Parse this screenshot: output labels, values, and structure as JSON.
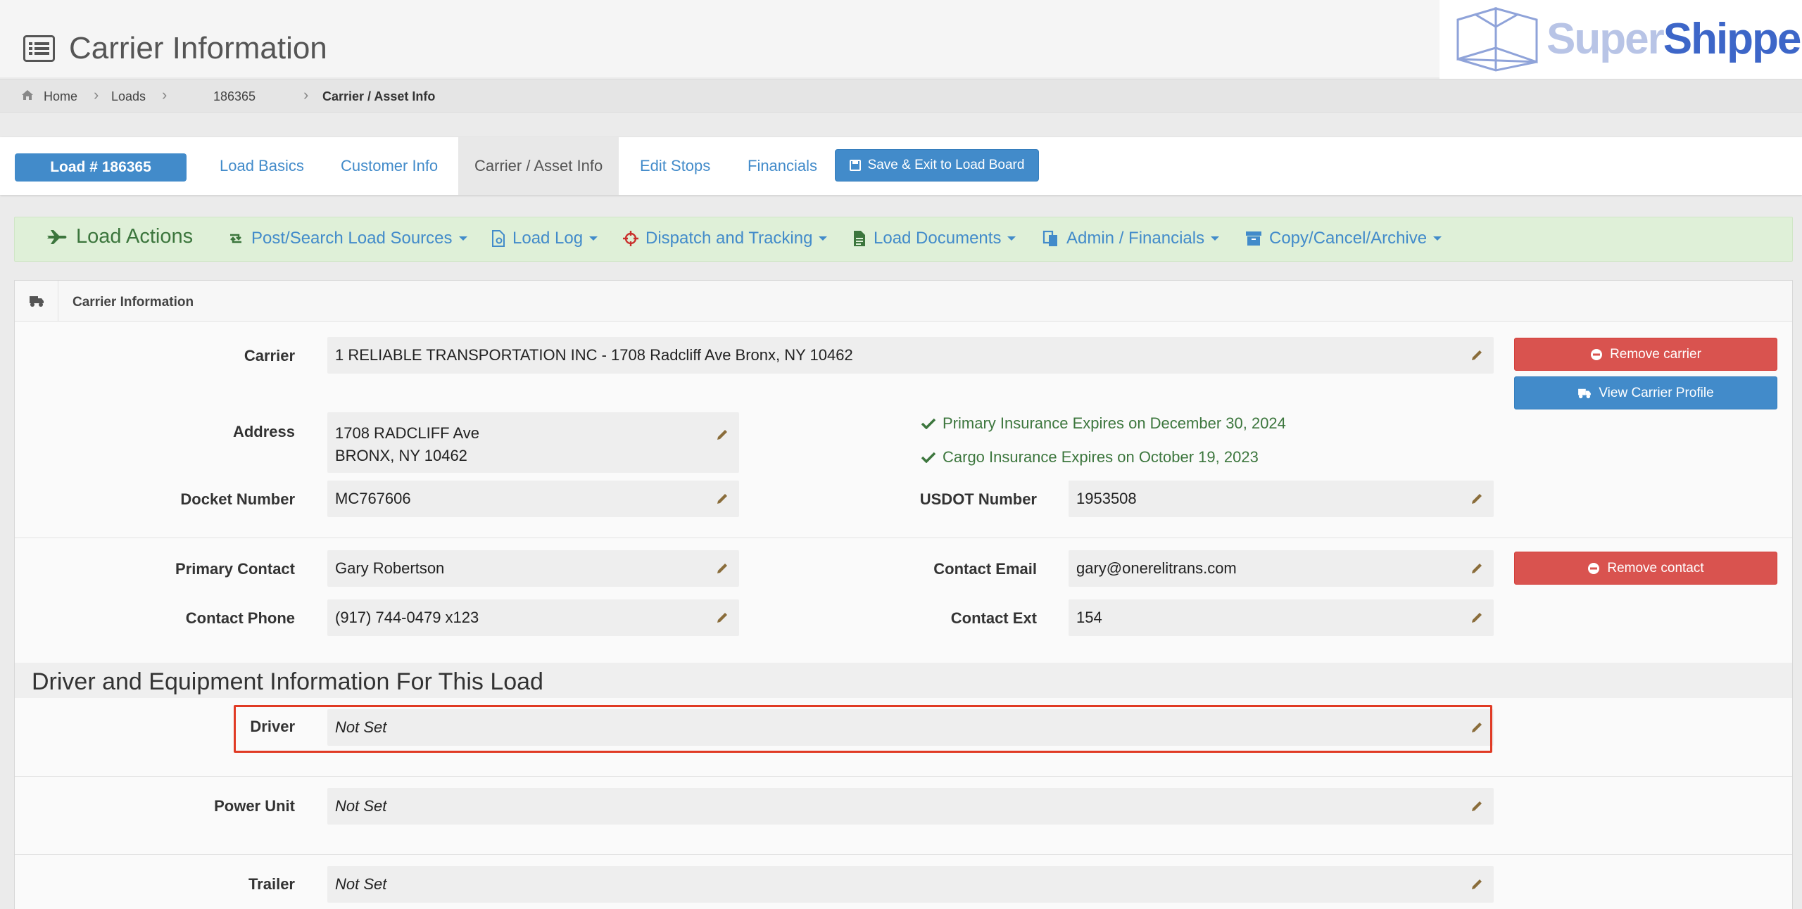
{
  "header": {
    "title": "Carrier Information",
    "brand_super": "Super",
    "brand_shippers": "Shippers"
  },
  "breadcrumb": {
    "home": "Home",
    "loads": "Loads",
    "load_id": "186365",
    "current": "Carrier / Asset Info"
  },
  "tabs": {
    "load_badge": "Load # 186365",
    "items": [
      "Load Basics",
      "Customer Info",
      "Carrier / Asset Info",
      "Edit Stops",
      "Financials"
    ],
    "save_label": "Save & Exit to Load Board"
  },
  "actions": {
    "title": "Load Actions",
    "items": [
      "Post/Search Load Sources",
      "Load Log",
      "Dispatch and Tracking",
      "Load Documents",
      "Admin / Financials",
      "Copy/Cancel/Archive"
    ]
  },
  "panel": {
    "title": "Carrier Information"
  },
  "carrier": {
    "carrier_label": "Carrier",
    "carrier_value": "1 RELIABLE TRANSPORTATION INC - 1708 Radcliff Ave Bronx, NY 10462",
    "address_label": "Address",
    "address_line1": "1708 RADCLIFF Ave",
    "address_line2": "BRONX, NY 10462",
    "docket_label": "Docket Number",
    "docket_value": "MC767606",
    "usdot_label": "USDOT Number",
    "usdot_value": "1953508",
    "primary_insurance": "Primary Insurance Expires on December 30, 2024",
    "cargo_insurance": "Cargo Insurance Expires on October 19, 2023",
    "remove_carrier": "Remove carrier",
    "view_profile": "View Carrier Profile"
  },
  "contact": {
    "primary_label": "Primary Contact",
    "primary_value": "Gary Robertson",
    "email_label": "Contact Email",
    "email_value": "gary@onerelitrans.com",
    "phone_label": "Contact Phone",
    "phone_value": "(917) 744-0479 x123",
    "ext_label": "Contact Ext",
    "ext_value": "154",
    "remove_contact": "Remove contact"
  },
  "driver_section": {
    "title": "Driver and Equipment Information For This Load",
    "driver_label": "Driver",
    "driver_value": "Not Set",
    "power_label": "Power Unit",
    "power_value": "Not Set",
    "trailer_label": "Trailer",
    "trailer_value": "Not Set"
  },
  "colors": {
    "primary": "#428bca",
    "danger": "#d9534f",
    "success": "#3c763d",
    "actions_bg": "#dff0d8",
    "highlight": "#e03a24",
    "pencil": "#8a6d3b"
  }
}
